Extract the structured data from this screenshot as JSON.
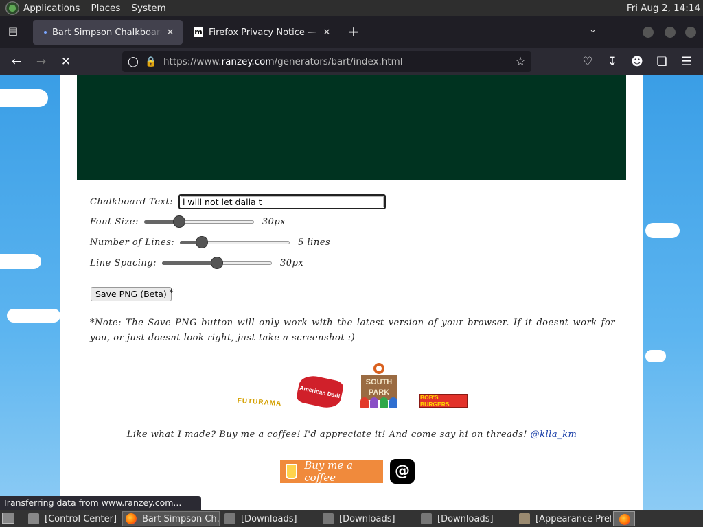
{
  "top_panel": {
    "menus": [
      "Applications",
      "Places",
      "System"
    ],
    "clock": "Fri Aug  2, 14:14"
  },
  "tabs": [
    {
      "title": "Bart Simpson Chalkboard Generator",
      "active": true
    },
    {
      "title": "Firefox Privacy Notice — Mozilla",
      "active": false,
      "favicon_letter": "m"
    }
  ],
  "urlbar": {
    "url_prefix": "https://www.",
    "url_host": "ranzey.com",
    "url_path": "/generators/bart/index.html"
  },
  "form": {
    "text_label": "Chalkboard Text:",
    "text_value": "i will not let dalia t",
    "font_size_label": "Font Size:",
    "font_size_value": "30px",
    "font_size_level": 0.32,
    "lines_label": "Number of Lines:",
    "lines_value": "5 lines",
    "lines_level": 0.2,
    "spacing_label": "Line Spacing:",
    "spacing_value": "30px",
    "spacing_level": 0.5,
    "save_button": "Save PNG (Beta)",
    "save_star": "*"
  },
  "note": "*Note: The Save PNG button will only work with the latest version of your browser. If it doesnt work for you, or just doesnt look right, just take a screenshot :)",
  "logos": {
    "futurama": "FUTURAMA",
    "american_dad": "American Dad!",
    "south_park": "SOUTH PARK",
    "bobs_burgers": "BOB'S BURGERS"
  },
  "footer": {
    "coffee_text": "Like what I made? Buy me a coffee! I'd appreciate it! And come say hi on threads!",
    "threads_handle": "@klla_km",
    "bmc_label": "Buy me a coffee",
    "threads_glyph": "@"
  },
  "status_text": "Transferring data from www.ranzey.com...",
  "taskbar": {
    "items": [
      "[Control Center]",
      "Bart Simpson Ch...",
      "[Downloads]",
      "[Downloads]",
      "[Downloads]",
      "[Appearance Pref..."
    ]
  },
  "colors": {
    "chalkboard": "#003320",
    "firefox_toolbar": "#2b2a33",
    "handle_link": "#1a3fa8",
    "bmc_orange": "#f08a3c"
  }
}
